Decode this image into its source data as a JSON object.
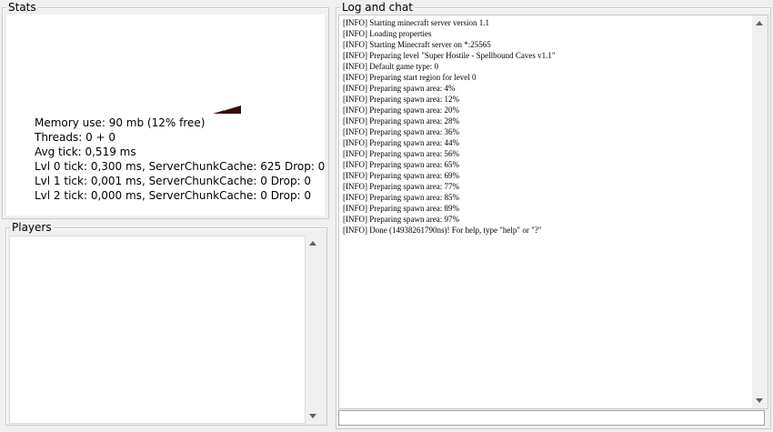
{
  "stats": {
    "title": "Stats",
    "lines": [
      "Memory use: 90 mb (12% free)",
      "Threads: 0 + 0",
      "Avg tick: 0,519 ms",
      "Lvl 0 tick: 0,300 ms, ServerChunkCache: 625 Drop: 0",
      "Lvl 1 tick: 0,001 ms, ServerChunkCache: 0 Drop: 0",
      "Lvl 2 tick: 0,000 ms, ServerChunkCache: 0 Drop: 0"
    ],
    "memory_graph": {
      "color": "#3a0a0a"
    }
  },
  "players": {
    "title": "Players",
    "items": []
  },
  "log": {
    "title": "Log and chat",
    "lines": [
      "[INFO] Starting minecraft server version 1.1",
      "[INFO] Loading properties",
      "[INFO] Starting Minecraft server on *:25565",
      "[INFO] Preparing level \"Super Hostile - Spellbound Caves v1.1\"",
      "[INFO] Default game type: 0",
      "[INFO] Preparing start region for level 0",
      "[INFO] Preparing spawn area: 4%",
      "[INFO] Preparing spawn area: 12%",
      "[INFO] Preparing spawn area: 20%",
      "[INFO] Preparing spawn area: 28%",
      "[INFO] Preparing spawn area: 36%",
      "[INFO] Preparing spawn area: 44%",
      "[INFO] Preparing spawn area: 56%",
      "[INFO] Preparing spawn area: 65%",
      "[INFO] Preparing spawn area: 69%",
      "[INFO] Preparing spawn area: 77%",
      "[INFO] Preparing spawn area: 85%",
      "[INFO] Preparing spawn area: 89%",
      "[INFO] Preparing spawn area: 97%",
      "[INFO] Done (14938261790ns)! For help, type \"help\" or \"?\""
    ],
    "input_value": ""
  }
}
